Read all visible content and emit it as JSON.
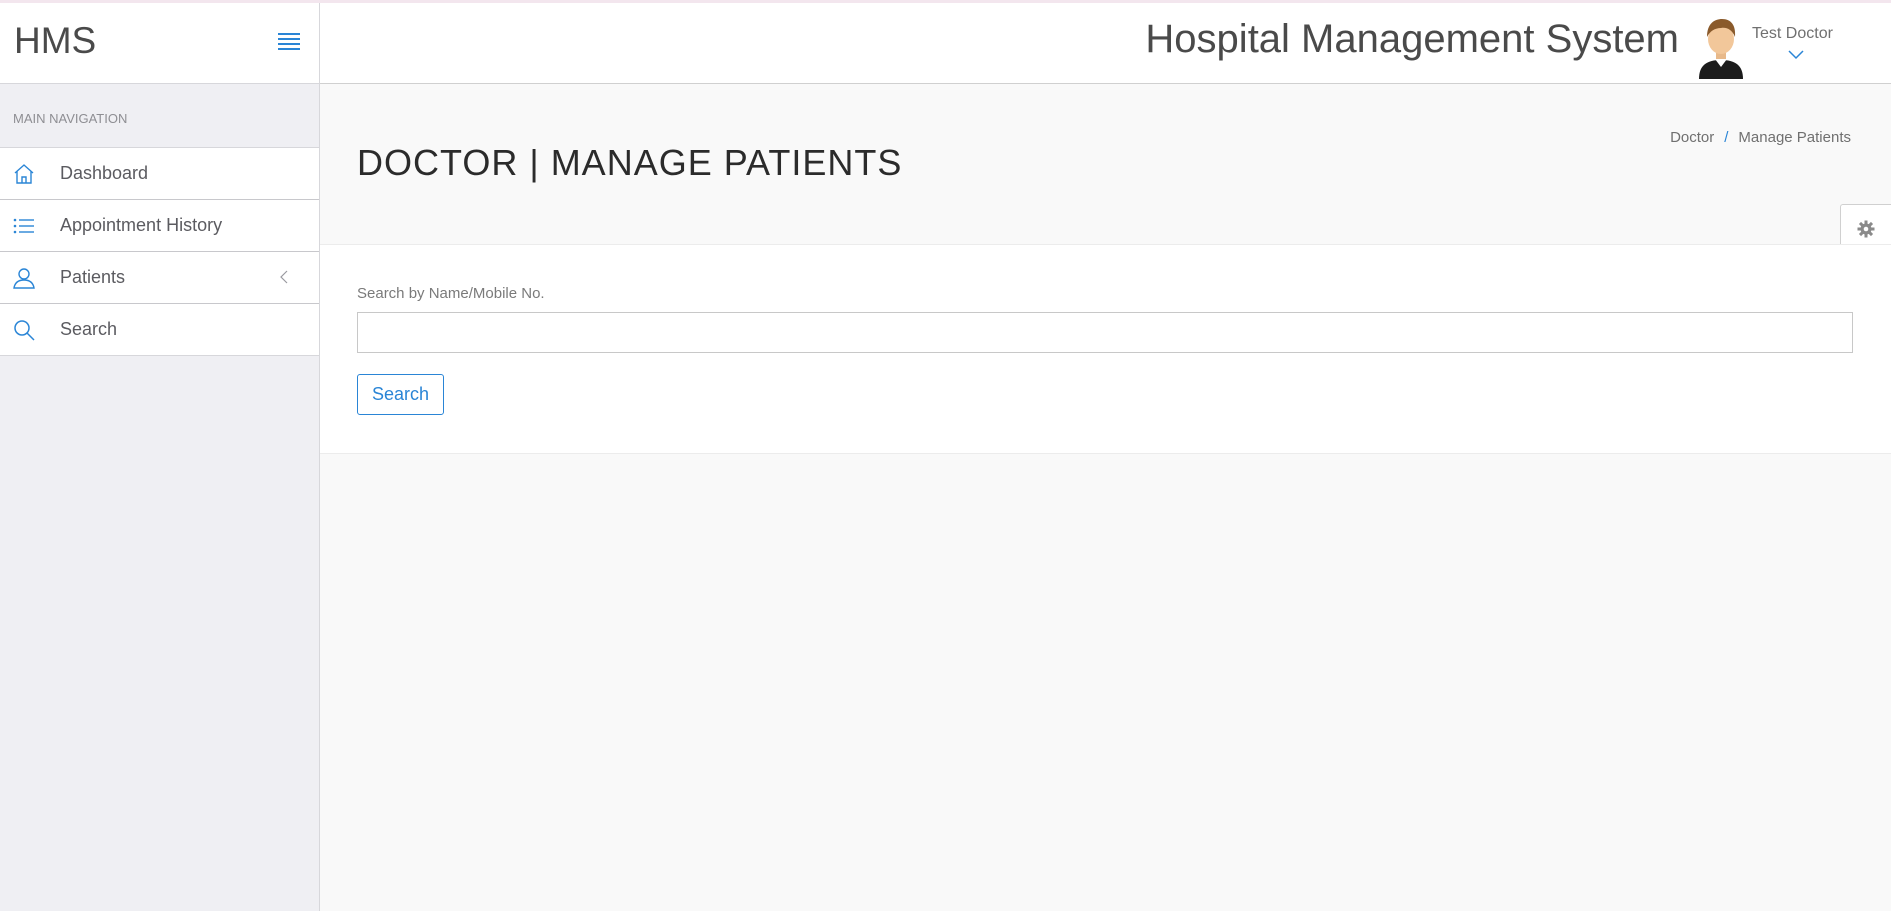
{
  "brand": {
    "name": "HMS"
  },
  "header": {
    "title": "Hospital Management System",
    "user_name": "Test Doctor"
  },
  "sidebar": {
    "heading": "MAIN NAVIGATION",
    "items": [
      {
        "label": "Dashboard",
        "icon": "home-icon"
      },
      {
        "label": "Appointment History",
        "icon": "list-icon"
      },
      {
        "label": "Patients",
        "icon": "user-icon",
        "has_submenu": true
      },
      {
        "label": "Search",
        "icon": "search-icon"
      }
    ]
  },
  "page": {
    "title": "Doctor | Manage Patients",
    "breadcrumb": [
      "Doctor",
      "Manage Patients"
    ]
  },
  "form": {
    "label": "Search by Name/Mobile No.",
    "input_value": "",
    "button_label": "Search"
  },
  "colors": {
    "accent": "#2a85d6",
    "sidebar_bg": "#efeff3",
    "page_bg": "#f9f9f9"
  }
}
